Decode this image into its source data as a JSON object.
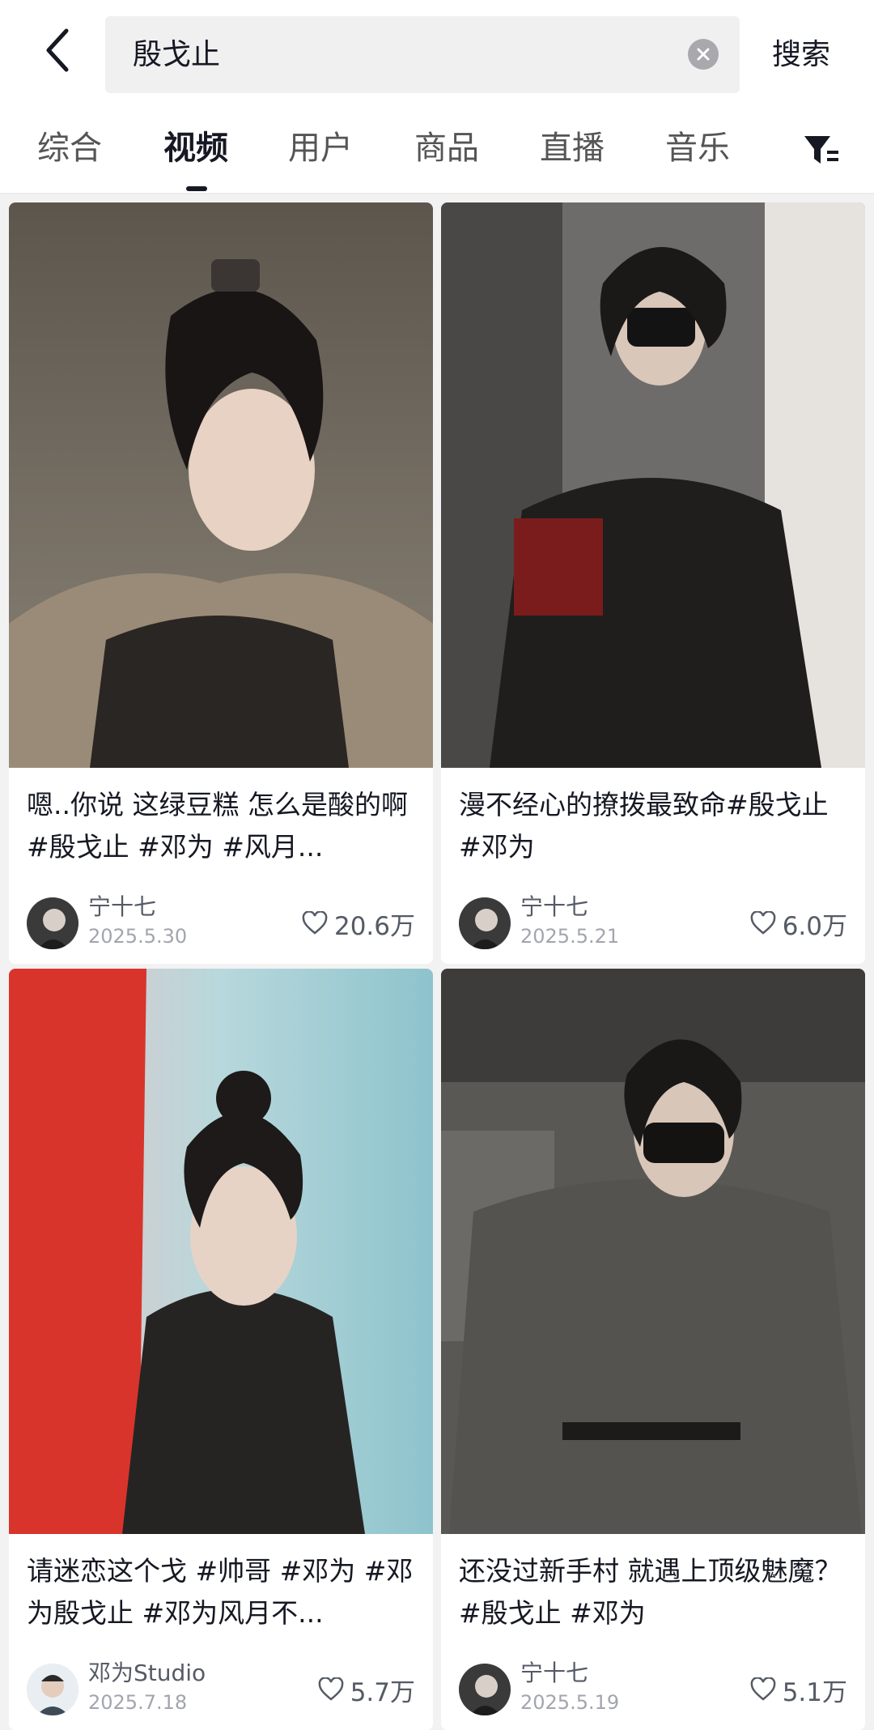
{
  "search": {
    "query": "殷戈止",
    "search_label": "搜索"
  },
  "tabs": [
    {
      "label": "综合"
    },
    {
      "label": "视频"
    },
    {
      "label": "用户"
    },
    {
      "label": "商品"
    },
    {
      "label": "直播"
    },
    {
      "label": "音乐"
    }
  ],
  "active_tab": "视频",
  "cards": [
    {
      "title": "嗯..你说 这绿豆糕 怎么是酸的啊 #殷戈止 #邓为 #风月...",
      "author": "宁十七",
      "date": "2025.5.30",
      "likes": "20.6万"
    },
    {
      "title": "漫不经心的撩拨最致命#殷戈止 #邓为",
      "author": "宁十七",
      "date": "2025.5.21",
      "likes": "6.0万"
    },
    {
      "title": "请迷恋这个戈 #帅哥 #邓为 #邓为殷戈止 #邓为风月不...",
      "author": "邓为Studio",
      "date": "2025.7.18",
      "likes": "5.7万"
    },
    {
      "title": "还没过新手村 就遇上顶级魅魔？#殷戈止 #邓为",
      "author": "宁十七",
      "date": "2025.5.19",
      "likes": "5.1万"
    }
  ],
  "colors": {
    "text": "#161823",
    "muted": "#a3a5ad",
    "background": "#f2f2f2"
  },
  "icons": [
    "back-arrow-icon",
    "clear-icon",
    "filter-icon",
    "heart-icon"
  ]
}
